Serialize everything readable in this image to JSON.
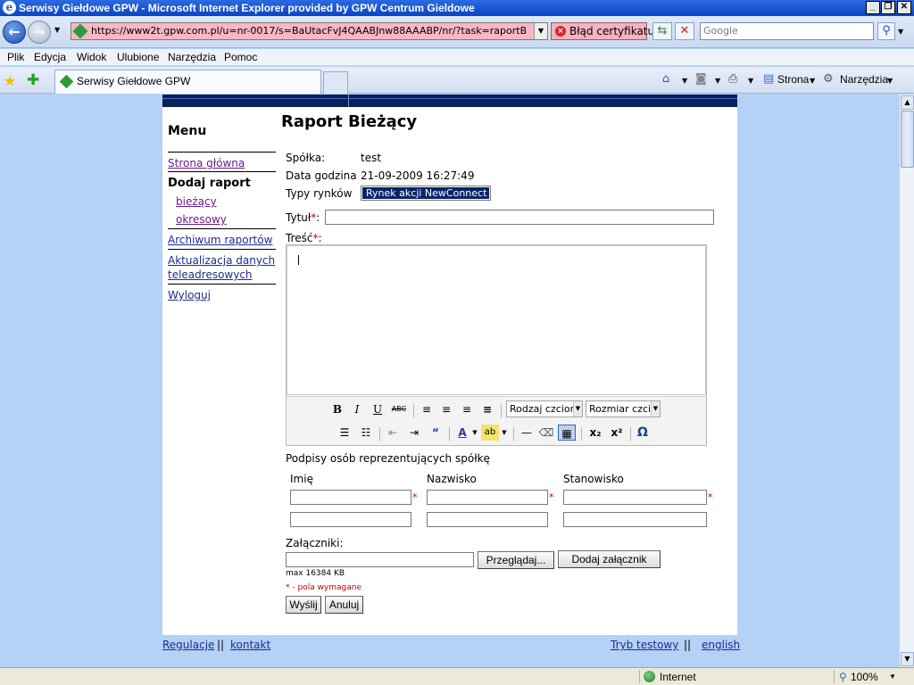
{
  "window": {
    "title": "Serwisy Giełdowe GPW - Microsoft Internet Explorer provided by GPW Centrum Gieldowe",
    "minimize": "_",
    "maximize": "❐",
    "close": "✕"
  },
  "address": {
    "url": "https://www2t.gpw.com.pl/u=nr-0017/s=BaUtacFvJ4QAABJnw88AAABP/nr/?task=raportB",
    "cert_error": "Błąd certyfikatu",
    "search_placeholder": "Google"
  },
  "menubar": [
    "Plik",
    "Edycja",
    "Widok",
    "Ulubione",
    "Narzędzia",
    "Pomoc"
  ],
  "tab": {
    "label": "Serwisy Giełdowe GPW"
  },
  "commandbar": {
    "page": "Strona",
    "tools": "Narzędzia"
  },
  "sidebar": {
    "title": "Menu",
    "items": [
      {
        "label": "Strona główna"
      },
      {
        "label": "Dodaj raport"
      },
      {
        "label": "bieżący"
      },
      {
        "label": "okresowy"
      },
      {
        "label": "Archiwum raportów"
      },
      {
        "label": "Aktualizacja danych"
      },
      {
        "label": "teleadresowych"
      },
      {
        "label": "Wyloguj"
      }
    ]
  },
  "report": {
    "title": "Raport Bieżący",
    "company_label": "Spółka:",
    "company_value": "test",
    "date_label": "Data godzina",
    "date_value": "21-09-2009 16:27:49",
    "market_label": "Typy rynków",
    "market_value": "Rynek akcji NewConnect",
    "title_label": "Tytuł",
    "content_label": "Treść",
    "required_mark": "*",
    "colon": ":"
  },
  "editor_toolbar": {
    "bold": "B",
    "italic": "I",
    "underline": "U",
    "strike": "ABC",
    "font_family": "Rodzaj czcionki",
    "font_size": "Rozmiar czcionki",
    "font_color": "A",
    "highlight": "ab",
    "subscript": "x₂",
    "superscript": "x²",
    "special_char": "Ω",
    "quote": "“"
  },
  "signatures": {
    "heading": "Podpisy osób reprezentujących spółkę",
    "col_first_name": "Imię",
    "col_last_name": "Nazwisko",
    "col_position": "Stanowisko"
  },
  "attachments": {
    "label": "Załączniki:",
    "browse": "Przeglądaj...",
    "add": "Dodaj załącznik",
    "max_size": "max 16384 KB",
    "required_note": "* - pola wymagane"
  },
  "actions": {
    "send": "Wyślij",
    "cancel": "Anuluj"
  },
  "footer": {
    "regulations": "Regulacje",
    "separator": "||",
    "contact": "kontakt",
    "test_mode": "Tryb testowy",
    "english": "english"
  },
  "statusbar": {
    "zone": "Internet",
    "zoom": "100%"
  }
}
